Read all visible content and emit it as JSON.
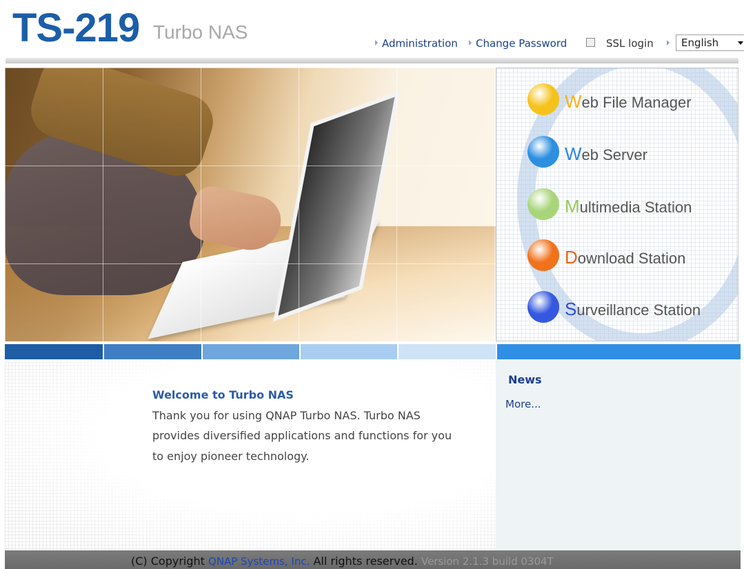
{
  "header": {
    "model": "TS-219",
    "product": "Turbo NAS",
    "links": {
      "administration": "Administration",
      "change_password": "Change Password"
    },
    "ssl_login": {
      "label": "SSL login",
      "checked": false
    },
    "language": {
      "selected": "English"
    }
  },
  "apps": [
    {
      "initial": "W",
      "rest": "eb File Manager",
      "color": "#f5c21c",
      "initial_color": "#f5b21c"
    },
    {
      "initial": "W",
      "rest": "eb Server",
      "color": "#2d8fe0",
      "initial_color": "#2a86d8"
    },
    {
      "initial": "M",
      "rest": "ultimedia Station",
      "color": "#a9d57a",
      "initial_color": "#95c85f"
    },
    {
      "initial": "D",
      "rest": "ownload Station",
      "color": "#f0731c",
      "initial_color": "#ee6216"
    },
    {
      "initial": "S",
      "rest": "urveillance Station",
      "color": "#3558e0",
      "initial_color": "#2f4fd6"
    }
  ],
  "strip_colors": [
    "#1e5ca6",
    "#3f7ec4",
    "#6fa6dd",
    "#a9cdf0",
    "#cfe3f7"
  ],
  "welcome": {
    "title": "Welcome to Turbo NAS",
    "lines": [
      "Thank you for using QNAP Turbo NAS. Turbo NAS",
      "provides diversified applications and functions for you",
      "to enjoy pioneer technology."
    ]
  },
  "news": {
    "title": "News",
    "more": "More..."
  },
  "footer": {
    "copyright_prefix": "(C) Copyright",
    "company": "QNAP Systems, Inc.",
    "rights": "All rights reserved.",
    "version": "Version 2.1.3 build 0304T"
  }
}
